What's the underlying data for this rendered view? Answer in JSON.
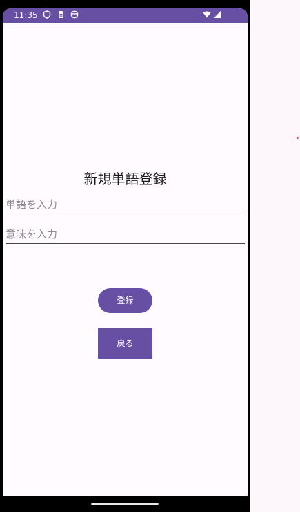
{
  "status_bar": {
    "time": "11:35",
    "left_icons": [
      "shield-icon",
      "sim-card-icon",
      "face-icon"
    ],
    "right_icons": [
      "wifi-icon",
      "signal-icon"
    ],
    "color": "#6750a4"
  },
  "screen": {
    "title": "新規単語登録",
    "word_field": {
      "placeholder": "単語を入力",
      "value": ""
    },
    "meaning_field": {
      "placeholder": "意味を入力",
      "value": ""
    },
    "register_button": "登録",
    "back_button": "戻る"
  },
  "colors": {
    "accent": "#6750a4",
    "background": "#fffbfe"
  }
}
